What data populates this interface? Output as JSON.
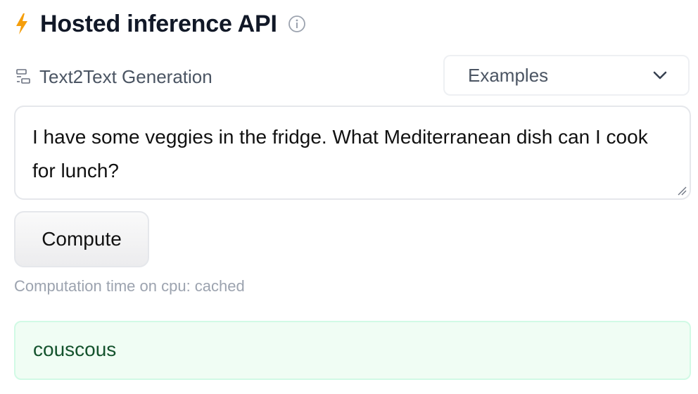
{
  "header": {
    "title": "Hosted inference API",
    "icons": {
      "bolt": "bolt-icon",
      "info": "info-icon"
    },
    "bolt_color": "#f59e0b"
  },
  "task": {
    "label": "Text2Text Generation",
    "icon": "text-generation-icon"
  },
  "examples": {
    "label": "Examples",
    "icon": "chevron-down-icon"
  },
  "input": {
    "value": "I have some veggies in the fridge. What Mediterranean dish can I cook for lunch?"
  },
  "compute": {
    "label": "Compute"
  },
  "status": {
    "computation_time": "Computation time on cpu: cached"
  },
  "output": {
    "text": "couscous",
    "background": "#f0fdf4",
    "border": "#d1fae5",
    "text_color": "#14532d"
  }
}
